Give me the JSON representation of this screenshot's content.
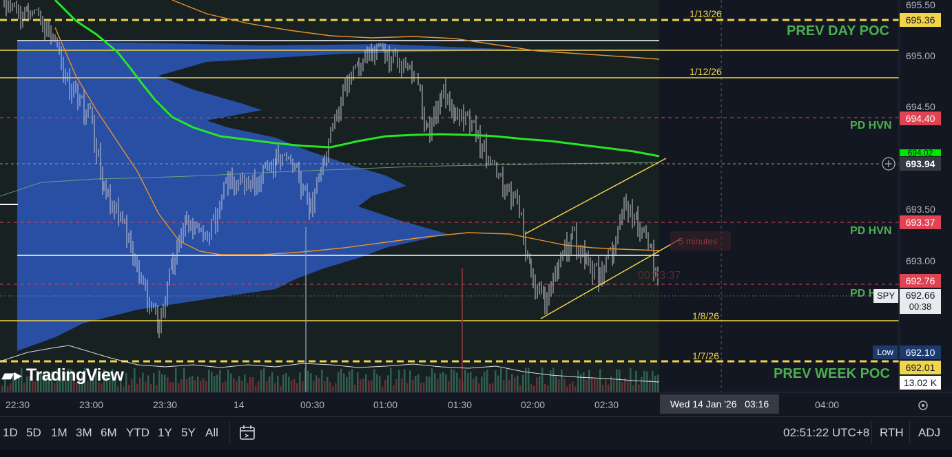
{
  "symbol": "SPY",
  "brand": "TradingView",
  "price_axis": [
    "695.50",
    "695.00",
    "694.50",
    "693.50",
    "693.00"
  ],
  "price_tags": {
    "prev_day_poc": {
      "value": "695.36",
      "bg": "#f0d44a",
      "fg": "#131722"
    },
    "pd_hvn_1": {
      "value": "694.40",
      "bg": "#e04352",
      "fg": "#ffffff"
    },
    "ma_green": {
      "value": "694.02",
      "bg": "#00e600",
      "fg": "#131722"
    },
    "crosshair": {
      "value": "693.94",
      "bg": "#363a45",
      "fg": "#ffffff"
    },
    "pd_hvn_2": {
      "value": "693.37",
      "bg": "#e04352",
      "fg": "#ffffff"
    },
    "red_level": {
      "value": "692.76",
      "bg": "#e04352",
      "fg": "#ffffff"
    },
    "last_price": {
      "value": "692.66",
      "countdown": "00:38",
      "bg": "#e9eaed",
      "fg": "#131722"
    },
    "low": {
      "label": "Low",
      "value": "692.10",
      "bg": "#1c3a6e",
      "fg": "#ffffff"
    },
    "prev_week_poc": {
      "value": "692.01",
      "bg": "#f0d44a",
      "fg": "#131722"
    },
    "volume": {
      "value": "13.02 K",
      "bg": "#ffffff",
      "fg": "#131722"
    }
  },
  "level_labels": {
    "prev_day_poc": "PREV DAY POC",
    "pd_hvn_1": "PD HVN",
    "pd_hvn_2": "PD HVN",
    "pd_hvn_3": "PD H",
    "prev_week_poc": "PREV WEEK POC"
  },
  "date_labels": [
    "1/13/26",
    "1/12/26",
    "1/8/26",
    "1/7/26"
  ],
  "overlay_text": {
    "interval": "5 minutes",
    "timer": "00:03:37"
  },
  "time_axis": [
    "22:30",
    "23:00",
    "23:30",
    "14",
    "00:30",
    "01:00",
    "01:30",
    "02:00",
    "02:30",
    "04:00"
  ],
  "crosshair_time": "Wed 14 Jan '26   03:16",
  "ranges": [
    "1D",
    "5D",
    "1M",
    "3M",
    "6M",
    "YTD",
    "1Y",
    "5Y",
    "All"
  ],
  "clock": "02:51:22 UTC+8",
  "session": "RTH",
  "adjust": "ADJ",
  "colors": {
    "bg": "#131722",
    "yellow": "#f0d44a",
    "green_ma": "#26e626",
    "orange": "#e8912d",
    "red_dash": "#e04352",
    "profile": "#2f5fd0"
  }
}
